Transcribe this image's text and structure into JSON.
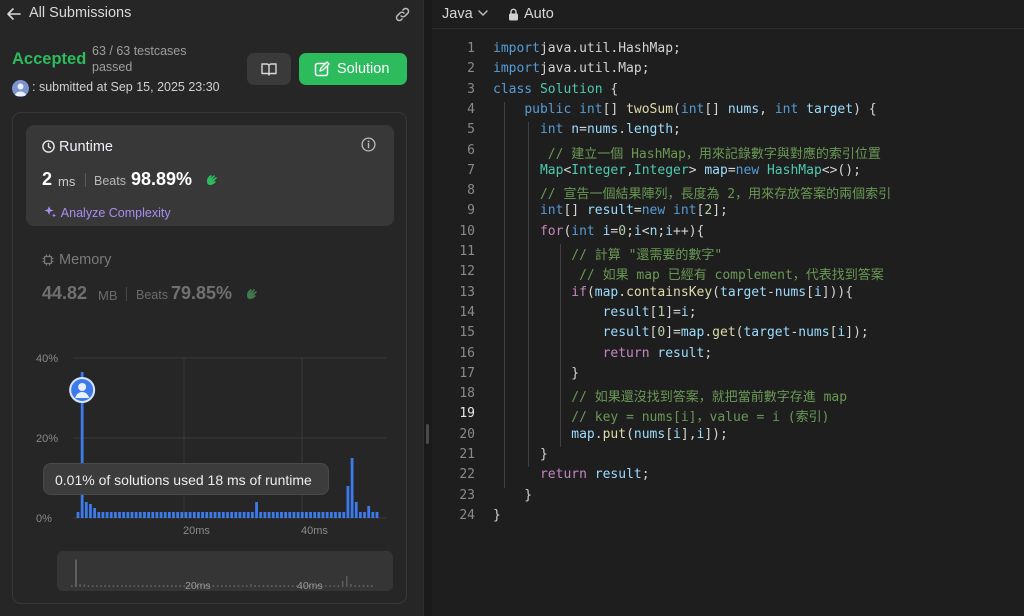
{
  "topbar": {
    "title": "All Submissions",
    "back_icon": "arrow-left-icon",
    "link_icon": "link-icon"
  },
  "submission": {
    "status": "Accepted",
    "status_color": "#2cbb5d",
    "testcases_line1": "63 / 63 testcases",
    "testcases_line2": "passed",
    "submitted": ": submitted at Sep 15, 2025 23:30"
  },
  "buttons": {
    "editorial_icon": "book-icon",
    "solution_label": "Solution",
    "solution_icon": "edit-icon",
    "accent": "#2cbb5d"
  },
  "runtime": {
    "title": "Runtime",
    "value": "2",
    "unit": "ms",
    "beats_label": "Beats",
    "beats_value": "98.89%",
    "analyze_label": "Analyze Complexity"
  },
  "memory": {
    "title": "Memory",
    "value": "44.82",
    "unit": "MB",
    "beats_label": "Beats",
    "beats_value": "79.85%"
  },
  "tooltip": {
    "text": "0.01% of solutions used 18 ms of runtime"
  },
  "chart_data": {
    "type": "bar",
    "title": "",
    "xlabel": "",
    "ylabel": "",
    "y_tick_labels": [
      "40%",
      "20%",
      "0%"
    ],
    "x_tick_labels": [
      "20ms",
      "40ms"
    ],
    "ylim": [
      0,
      40
    ],
    "highlight_value": 36.5,
    "values": [
      1.5,
      36.5,
      4,
      3.5,
      2.5,
      1.5,
      1.5,
      1.5,
      1.5,
      1.5,
      1.5,
      1.5,
      1.5,
      1.5,
      1.5,
      1.5,
      1.5,
      1.5,
      1.5,
      1.5,
      1.5,
      1.5,
      1.5,
      1.5,
      1.5,
      1.5,
      1.5,
      1.5,
      1.5,
      1.5,
      1.5,
      1.5,
      1.5,
      1.5,
      1.5,
      1.5,
      1.5,
      1.5,
      1.5,
      1.5,
      1.5,
      1.5,
      1.5,
      4,
      1.5,
      1.5,
      1.5,
      1.5,
      1.5,
      1.5,
      1.5,
      1.5,
      1.5,
      1.5,
      1.5,
      1.5,
      1.5,
      1.5,
      1.5,
      1.5,
      1.5,
      1.5,
      1.5,
      1.5,
      1.5,
      8,
      15,
      4,
      1.5,
      1.5,
      3,
      1.5,
      1.5
    ],
    "bar_color": "#3d7bea",
    "grid": true
  },
  "editor": {
    "language": "Java",
    "mode": "Auto",
    "current_line": 19,
    "lines": [
      [
        [
          "kb",
          "import"
        ],
        [
          "",
          "java.util.HashMap;"
        ]
      ],
      [
        [
          "kb",
          "import"
        ],
        [
          "",
          "java.util.Map;"
        ]
      ],
      [
        [
          "kb",
          "class"
        ],
        [
          "",
          ""
        ],
        [
          "ty",
          "Solution"
        ],
        [
          "",
          " {"
        ]
      ],
      [
        [
          "",
          "    "
        ],
        [
          "kb",
          "public"
        ],
        [
          "",
          ""
        ],
        [
          "kb",
          "int"
        ],
        [
          "",
          "[] "
        ],
        [
          "fn",
          "twoSum"
        ],
        [
          "",
          "("
        ],
        [
          "kb",
          "int"
        ],
        [
          "",
          "[] "
        ],
        [
          "vr",
          "nums"
        ],
        [
          ", "
        ],
        [
          "kb",
          "int"
        ],
        [
          "",
          ""
        ],
        [
          "vr",
          "target"
        ],
        [
          "",
          ") {"
        ]
      ],
      [
        [
          "",
          "      "
        ],
        [
          "kb",
          "int"
        ],
        [
          "",
          ""
        ],
        [
          "vr",
          "n"
        ],
        [
          "",
          "="
        ],
        [
          "vr",
          "nums"
        ],
        [
          "",
          "."
        ],
        [
          "vr",
          "length"
        ],
        [
          "",
          ";"
        ]
      ],
      [
        [
          "",
          "       "
        ],
        [
          "cm",
          "// 建立一個 HashMap，用來記錄數字與對應的索引位置"
        ]
      ],
      [
        [
          "",
          "      "
        ],
        [
          "ty",
          "Map"
        ],
        [
          "",
          "<"
        ],
        [
          "ty",
          "Integer"
        ],
        [
          "",
          ","
        ],
        [
          "ty",
          "Integer"
        ],
        [
          "",
          "> "
        ],
        [
          "vr",
          "map"
        ],
        [
          "",
          "="
        ],
        [
          "kb",
          "new"
        ],
        [
          "",
          ""
        ],
        [
          "ty",
          "HashMap"
        ],
        [
          "",
          "<>();"
        ]
      ],
      [
        [
          "",
          "      "
        ],
        [
          "cm",
          "// 宣告一個結果陣列，長度為 2，用來存放答案的兩個索引"
        ]
      ],
      [
        [
          "",
          "      "
        ],
        [
          "kb",
          "int"
        ],
        [
          "",
          "[] "
        ],
        [
          "vr",
          "result"
        ],
        [
          "",
          "="
        ],
        [
          "kb",
          "new"
        ],
        [
          "",
          ""
        ],
        [
          "kb",
          "int"
        ],
        [
          "",
          "["
        ],
        [
          "nm",
          "2"
        ],
        [
          "",
          "];"
        ]
      ],
      [
        [
          "",
          "      "
        ],
        [
          "kw",
          "for"
        ],
        [
          "",
          "("
        ],
        [
          "kb",
          "int"
        ],
        [
          "",
          ""
        ],
        [
          "vr",
          "i"
        ],
        [
          "",
          "="
        ],
        [
          "nm",
          "0"
        ],
        [
          "",
          ";"
        ],
        [
          "vr",
          "i"
        ],
        [
          "",
          "<"
        ],
        [
          "vr",
          "n"
        ],
        [
          "",
          ";"
        ],
        [
          "vr",
          "i"
        ],
        [
          "",
          "++){"
        ]
      ],
      [
        [
          "",
          "          "
        ],
        [
          "cm",
          "// 計算 \"還需要的數字\""
        ]
      ],
      [
        [
          "",
          "           "
        ],
        [
          "cm",
          "// 如果 map 已經有 complement，代表找到答案"
        ]
      ],
      [
        [
          "",
          "          "
        ],
        [
          "kw",
          "if"
        ],
        [
          "",
          "("
        ],
        [
          "vr",
          "map"
        ],
        [
          "",
          "."
        ],
        [
          "fn",
          "containsKey"
        ],
        [
          "",
          "("
        ],
        [
          "vr",
          "target"
        ],
        [
          "",
          "-"
        ],
        [
          "vr",
          "nums"
        ],
        [
          "",
          "["
        ],
        [
          "vr",
          "i"
        ],
        [
          "",
          "])){"
        ]
      ],
      [
        [
          "",
          "              "
        ],
        [
          "vr",
          "result"
        ],
        [
          "",
          "["
        ],
        [
          "nm",
          "1"
        ],
        [
          "",
          "]="
        ],
        [
          "vr",
          "i"
        ],
        [
          "",
          ";"
        ]
      ],
      [
        [
          "",
          "              "
        ],
        [
          "vr",
          "result"
        ],
        [
          "",
          "["
        ],
        [
          "nm",
          "0"
        ],
        [
          "",
          "]="
        ],
        [
          "vr",
          "map"
        ],
        [
          "",
          "."
        ],
        [
          "fn",
          "get"
        ],
        [
          "",
          "("
        ],
        [
          "vr",
          "target"
        ],
        [
          "",
          "-"
        ],
        [
          "vr",
          "nums"
        ],
        [
          "",
          "["
        ],
        [
          "vr",
          "i"
        ],
        [
          "",
          "]);"
        ]
      ],
      [
        [
          "",
          "              "
        ],
        [
          "kw",
          "return"
        ],
        [
          "",
          ""
        ],
        [
          "vr",
          "result"
        ],
        [
          "",
          ";"
        ]
      ],
      [
        [
          "",
          "          }"
        ]
      ],
      [
        [
          "",
          "          "
        ],
        [
          "cm",
          "// 如果還沒找到答案，就把當前數字存進 map"
        ]
      ],
      [
        [
          "",
          "          "
        ],
        [
          "cm",
          "// key = nums[i]，value = i (索引)"
        ]
      ],
      [
        [
          "",
          "          "
        ],
        [
          "vr",
          "map"
        ],
        [
          "",
          "."
        ],
        [
          "fn",
          "put"
        ],
        [
          "",
          "("
        ],
        [
          "vr",
          "nums"
        ],
        [
          "",
          "["
        ],
        [
          "vr",
          "i"
        ],
        [
          "",
          "],"
        ],
        [
          "vr",
          "i"
        ],
        [
          "",
          "]);"
        ]
      ],
      [
        [
          "",
          "      }"
        ]
      ],
      [
        [
          "",
          "      "
        ],
        [
          "kw",
          "return"
        ],
        [
          "",
          ""
        ],
        [
          "vr",
          "result"
        ],
        [
          "",
          ";"
        ]
      ],
      [
        [
          "",
          "    }"
        ]
      ],
      [
        [
          "",
          "}"
        ]
      ]
    ]
  }
}
